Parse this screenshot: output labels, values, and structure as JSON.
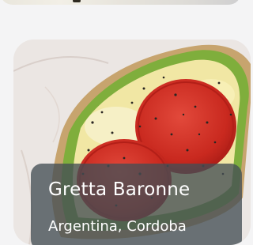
{
  "card": {
    "name": "Gretta Baronne",
    "location": "Argentina, Cordoba"
  }
}
